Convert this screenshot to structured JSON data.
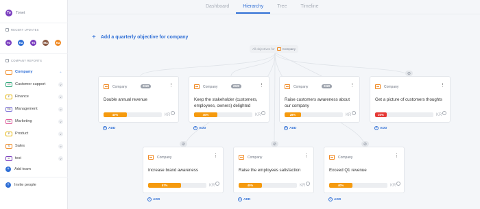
{
  "sidebar": {
    "user": {
      "initials": "To",
      "label": "Tonet"
    },
    "recent_heading": "RECENT UPDATES",
    "recent": [
      {
        "initials": "To",
        "color": "#7b3fbf"
      },
      {
        "initials": "Ka",
        "color": "#2f6fd6"
      },
      {
        "initials": "To",
        "color": "#7b3fbf"
      },
      {
        "initials": "Ma",
        "color": "#8a5a44"
      },
      {
        "initials": "Ka",
        "color": "#f08a24"
      }
    ],
    "reports_heading": "COMPANY REPORTS",
    "items": [
      {
        "label": "Company",
        "abbr": "",
        "color": "#f08a24",
        "active": true
      },
      {
        "label": "Customer support",
        "abbr": "CS",
        "color": "#2fa87a",
        "active": false
      },
      {
        "label": "Finance",
        "abbr": "F",
        "color": "#e6b400",
        "active": false
      },
      {
        "label": "Management",
        "abbr": "Ma",
        "color": "#7b6fd6",
        "active": false
      },
      {
        "label": "Marketing",
        "abbr": "Ma",
        "color": "#e05a9a",
        "active": false
      },
      {
        "label": "Product",
        "abbr": "P",
        "color": "#e6b400",
        "active": false
      },
      {
        "label": "Sales",
        "abbr": "S",
        "color": "#f08a24",
        "active": false
      },
      {
        "label": "test",
        "abbr": "te",
        "color": "#7b3fbf",
        "active": false
      }
    ],
    "add_team": "Add team",
    "invite": "Invite people"
  },
  "tabs": [
    "Dashboard",
    "Hierarchy",
    "Tree",
    "Timeline"
  ],
  "active_tab": "Hierarchy",
  "add_objective": "Add a quarterly objective for company",
  "all_objectives": {
    "prefix": "All objectives for",
    "company": "Company"
  },
  "cards": [
    {
      "company": "Company",
      "year": "2020",
      "title": "Double annual revenue",
      "progress": 40,
      "progress_label": "40%",
      "color": "#f59a0e",
      "kr": "KR"
    },
    {
      "company": "Company",
      "year": "2020",
      "title": "Keep the stakeholder (customers, employees, owners) delighted",
      "progress": 40,
      "progress_label": "40%",
      "color": "#f59a0e",
      "kr": "KR"
    },
    {
      "company": "Company",
      "year": "2020",
      "title": "Raise customers awareness about our company",
      "progress": 28,
      "progress_label": "28%",
      "color": "#f59a0e",
      "kr": "KR"
    },
    {
      "company": "Company",
      "year": "",
      "title": "Get a picture of customers thoughts",
      "progress": 20,
      "progress_label": "20%",
      "color": "#e53935",
      "kr": "KR"
    },
    {
      "company": "Company",
      "year": "",
      "title": "Increase brand awareness",
      "progress": 57,
      "progress_label": "57%",
      "color": "#f59a0e",
      "kr": "KR"
    },
    {
      "company": "Company",
      "year": "",
      "title": "Raise the employees satisfaction",
      "progress": 40,
      "progress_label": "40%",
      "color": "#f59a0e",
      "kr": "KR"
    },
    {
      "company": "Company",
      "year": "",
      "title": "Exceed Q1 revenue",
      "progress": 40,
      "progress_label": "40%",
      "color": "#f59a0e",
      "kr": "KR"
    }
  ],
  "add_label": "ADD",
  "menu_glyph": "⋮"
}
